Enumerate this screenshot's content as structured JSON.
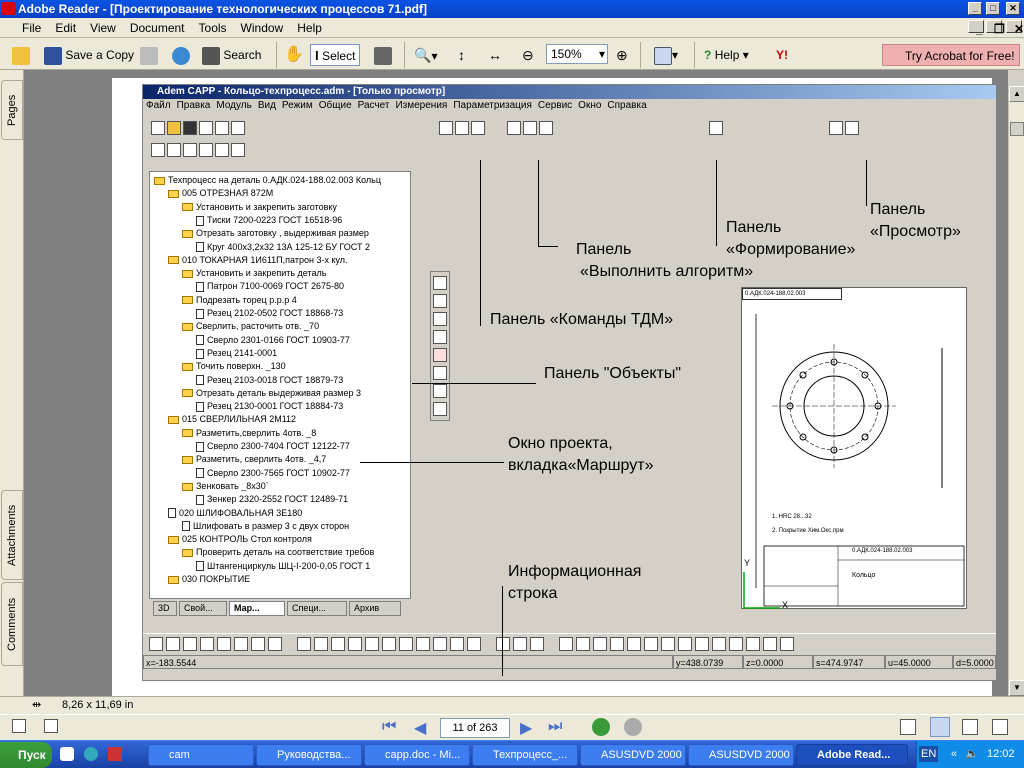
{
  "window": {
    "title": "Adobe Reader - [Проектирование технологических процессов 71.pdf]"
  },
  "menu": [
    "File",
    "Edit",
    "View",
    "Document",
    "Tools",
    "Window",
    "Help"
  ],
  "toolbar": {
    "save_copy": "Save a Copy",
    "search": "Search",
    "select": "Select",
    "zoom": "150%",
    "help": "Help",
    "try_acrobat": "Try Acrobat for Free!"
  },
  "side_tabs": [
    "Pages",
    "Attachments",
    "Comments"
  ],
  "status": {
    "page_size": "8,26 x 11,69 in"
  },
  "nav": {
    "page_field": "11 of 263"
  },
  "taskbar": {
    "start": "Пуск",
    "tasks": [
      "cam",
      "Руководства...",
      "capp.doc - Mi...",
      "Техпроцесс_...",
      "ASUSDVD 2000",
      "ASUSDVD 2000",
      "Adobe Read..."
    ],
    "lang": "EN",
    "clock": "12:02"
  },
  "adem": {
    "title": "Adem CAPP - Кольцо-техпроцесс.adm - [Только просмотр]",
    "menu": [
      "Файл",
      "Правка",
      "Модуль",
      "Вид",
      "Режим",
      "Общие",
      "Расчет",
      "Измерения",
      "Параметризация",
      "Сервис",
      "Окно",
      "Справка"
    ],
    "tree": [
      {
        "l": 0,
        "t": "f",
        "txt": "Техпроцесс на деталь 0.АДК.024-188.02.003 Кольц"
      },
      {
        "l": 1,
        "t": "f",
        "txt": "005  ОТРЕЗНАЯ 872М"
      },
      {
        "l": 2,
        "t": "f",
        "txt": "Установить и закрепить заготовку"
      },
      {
        "l": 3,
        "t": "d",
        "txt": "Тиски 7200-0223 ГОСТ 16518-96"
      },
      {
        "l": 2,
        "t": "f",
        "txt": "Отрезать заготовку , выдерживая размер"
      },
      {
        "l": 3,
        "t": "d",
        "txt": "Круг 400х3,2х32 13А 125-12 БУ ГОСТ 2"
      },
      {
        "l": 1,
        "t": "f",
        "txt": "010  ТОКАРНАЯ 1И611П,патрон 3-х кул."
      },
      {
        "l": 2,
        "t": "f",
        "txt": "Установить и закрепить деталь"
      },
      {
        "l": 3,
        "t": "d",
        "txt": "Патрон 7100-0069 ГОСТ 2675-80"
      },
      {
        "l": 2,
        "t": "f",
        "txt": "Подрезать торец  р.р.р 4"
      },
      {
        "l": 3,
        "t": "d",
        "txt": "Резец 2102-0502  ГОСТ 18868-73"
      },
      {
        "l": 2,
        "t": "f",
        "txt": "Сверлить, расточить отв.  _70"
      },
      {
        "l": 3,
        "t": "d",
        "txt": "Сверло 2301-0166  ГОСТ 10903-77"
      },
      {
        "l": 3,
        "t": "d",
        "txt": "Резец 2141-0001"
      },
      {
        "l": 2,
        "t": "f",
        "txt": "Точить поверхн. _130"
      },
      {
        "l": 3,
        "t": "d",
        "txt": "Резец 2103-0018  ГОСТ 18879-73"
      },
      {
        "l": 2,
        "t": "f",
        "txt": "Отрезать деталь выдерживая размер 3"
      },
      {
        "l": 3,
        "t": "d",
        "txt": "Резец 2130-0001  ГОСТ 18884-73"
      },
      {
        "l": 1,
        "t": "f",
        "txt": "015  СВЕРЛИЛЬНАЯ 2М112"
      },
      {
        "l": 2,
        "t": "f",
        "txt": "Разметить,сверлить 4отв.  _8"
      },
      {
        "l": 3,
        "t": "d",
        "txt": "Сверло 2300-7404  ГОСТ 12122-77"
      },
      {
        "l": 2,
        "t": "f",
        "txt": "Разметить, сверлить  4отв.  _4,7"
      },
      {
        "l": 3,
        "t": "d",
        "txt": "Сверло 2300-7565  ГОСТ 10902-77"
      },
      {
        "l": 2,
        "t": "f",
        "txt": "Зенковать  _8х30`"
      },
      {
        "l": 3,
        "t": "d",
        "txt": "Зенкер 2320-2552  ГОСТ 12489-71"
      },
      {
        "l": 1,
        "t": "d",
        "txt": "020  ШЛИФОВАЛЬНАЯ 3Е180"
      },
      {
        "l": 2,
        "t": "d",
        "txt": "Шлифовать в размер  3 с двух сторон"
      },
      {
        "l": 1,
        "t": "f",
        "txt": "025  КОНТРОЛЬ Стол контроля"
      },
      {
        "l": 2,
        "t": "f",
        "txt": "Проверить деталь на соответствие требов"
      },
      {
        "l": 3,
        "t": "d",
        "txt": "Штангенциркуль ШЦ-I-200-0,05 ГОСТ 1"
      },
      {
        "l": 1,
        "t": "f",
        "txt": "030  ПОКРЫТИЕ"
      }
    ],
    "tabs": [
      "3D",
      "Свой...",
      "Мар...",
      "Специ...",
      "Архив"
    ],
    "info": [
      "x=-183.5544",
      "y=438.0739",
      "z=0.0000",
      "s=474.9747",
      "u=45.0000",
      "d=5.0000"
    ],
    "drawing": {
      "stamp": "0.АДК.024-188.02.003",
      "name": "Кольцо",
      "note1": "1. HRC 28...32",
      "note2": "2. Покрытие  Хим.Окс.прм",
      "axis_y": "Y",
      "axis_x": "X"
    }
  },
  "callouts": {
    "tdm": "Панель «Команды ТДМ»",
    "algo1": "Панель",
    "algo2": "«Выполнить алгоритм»",
    "form1": "Панель",
    "form2": "«Формирование»",
    "view1": "Панель",
    "view2": "«Просмотр»",
    "objects": "Панель \"Объекты\"",
    "proj1": "Окно проекта,",
    "proj2": "вкладка«Маршрут»",
    "info1": "Информационная",
    "info2": "строка"
  }
}
